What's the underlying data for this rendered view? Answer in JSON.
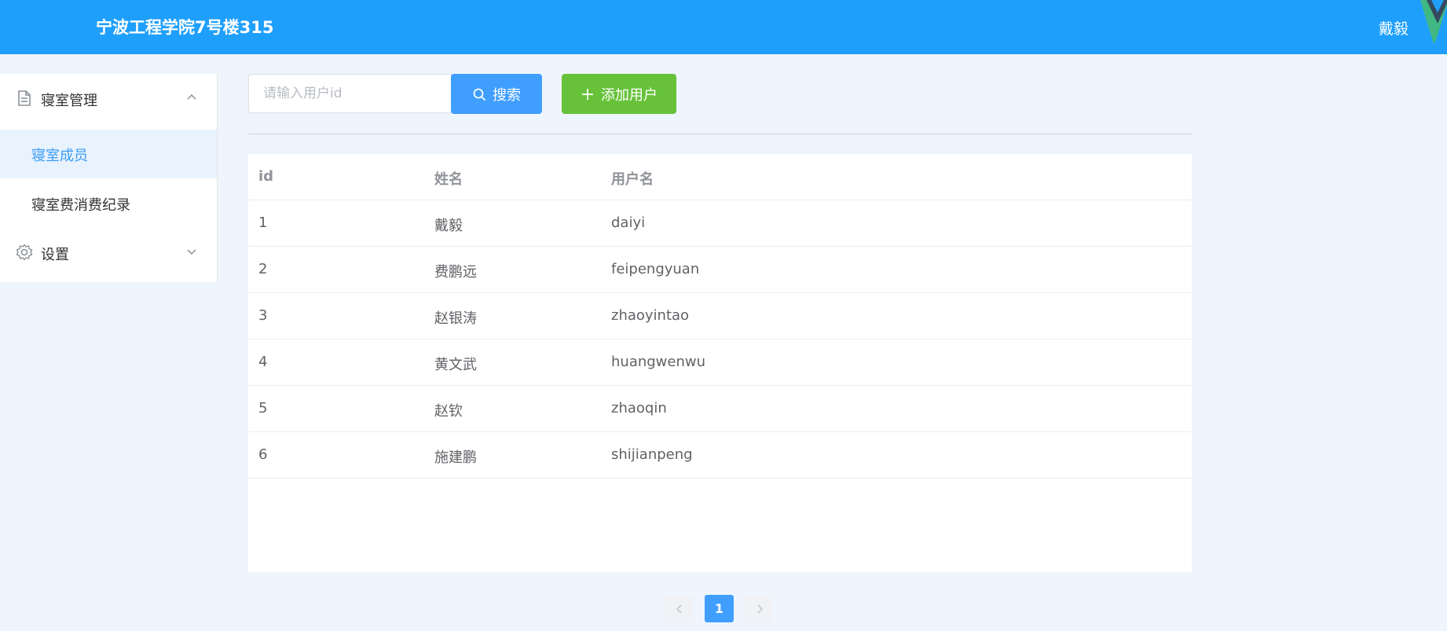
{
  "header": {
    "title": "宁波工程学院7号楼315",
    "user": "戴毅",
    "logo_icon": "vue-logo-icon"
  },
  "sidebar": {
    "groups": [
      {
        "label": "寝室管理",
        "icon": "document-icon",
        "expanded": true,
        "items": [
          {
            "label": "寝室成员",
            "active": true
          },
          {
            "label": "寝室费消费纪录",
            "active": false
          }
        ]
      },
      {
        "label": "设置",
        "icon": "gear-icon",
        "expanded": false,
        "items": []
      }
    ]
  },
  "toolbar": {
    "search_placeholder": "请输入用户id",
    "search_value": "",
    "search_label": "搜索",
    "add_label": "添加用户"
  },
  "table": {
    "columns": [
      "id",
      "姓名",
      "用户名"
    ],
    "rows": [
      [
        "1",
        "戴毅",
        "daiyi"
      ],
      [
        "2",
        "费鹏远",
        "feipengyuan"
      ],
      [
        "3",
        "赵银涛",
        "zhaoyintao"
      ],
      [
        "4",
        "黄文武",
        "huangwenwu"
      ],
      [
        "5",
        "赵钦",
        "zhaoqin"
      ],
      [
        "6",
        "施建鹏",
        "shijianpeng"
      ]
    ]
  },
  "pagination": {
    "current_page": "1"
  },
  "colors": {
    "header": "#1f9ffc",
    "primary": "#409eff",
    "success": "#67c23a",
    "active_menu_text": "#3a9bf5",
    "page_bg": "#eef5fd"
  }
}
